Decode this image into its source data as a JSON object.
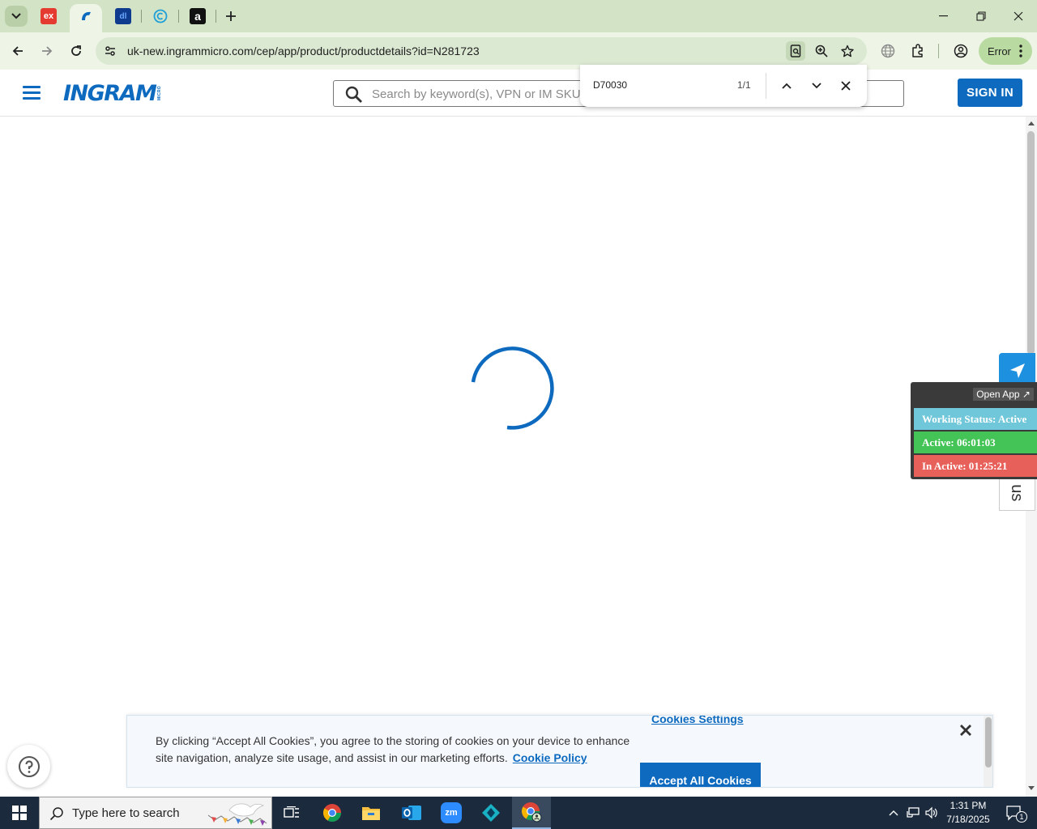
{
  "browser": {
    "tabs": [
      {
        "icon": "expansys-icon",
        "glyph": "ex",
        "color": "#e53a2f"
      },
      {
        "icon": "ingram-micro-icon",
        "glyph": "",
        "color": "#0d6abf",
        "active": true
      },
      {
        "icon": "dl-icon",
        "glyph": "dl",
        "color": "#0f3b8f"
      },
      {
        "icon": "copyright-icon",
        "glyph": "©",
        "color": "#1fa0d8"
      },
      {
        "icon": "amazon-icon",
        "glyph": "a",
        "color": "#111111"
      }
    ],
    "url": "uk-new.ingrammicro.com/cep/app/product/productdetails?id=N281723",
    "profile_chip": "Error"
  },
  "find_bar": {
    "query": "D70030",
    "match_count": "1/1"
  },
  "header": {
    "logo_text": "INGRAM",
    "logo_sub": "MICRO",
    "search_placeholder": "Search by keyword(s), VPN or IM SKU",
    "sign_in": "SIGN IN"
  },
  "side_widgets": {
    "partner_label": "Partner with us",
    "open_app": "Open App ↗",
    "working_status": "Working Status: Active",
    "active_time": "Active: 06:01:03",
    "inactive_time": "In Active: 01:25:21"
  },
  "cookie_banner": {
    "settings_link": "Cookies Settings",
    "message": "By clicking “Accept All Cookies”, you agree to the storing of cookies on your device to enhance site navigation, analyze site usage, and assist in our marketing efforts.",
    "policy_link": "Cookie Policy",
    "accept_button": "Accept All Cookies"
  },
  "taskbar": {
    "search_placeholder": "Type here to search",
    "time": "1:31 PM",
    "date": "7/18/2025",
    "notification_count": "1"
  },
  "colors": {
    "brand_blue": "#0d6abf",
    "working_status": "#6fc7d9",
    "active": "#44c456",
    "inactive": "#e8605a"
  }
}
